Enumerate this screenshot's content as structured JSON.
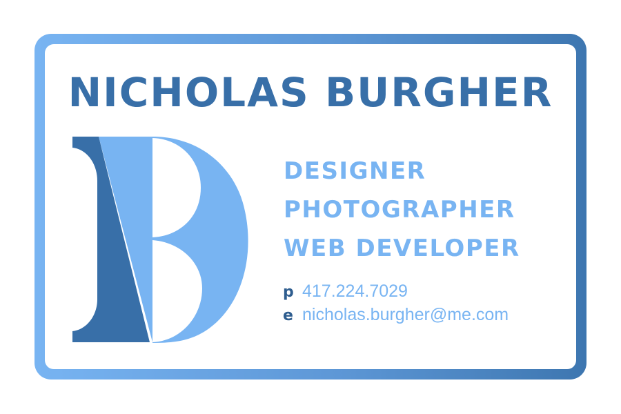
{
  "card": {
    "name": "NICHOLAS BURGHER",
    "monogram_letter": "B",
    "titles": [
      "DESIGNER",
      "PHOTOGRAPHER",
      "WEB DEVELOPER"
    ],
    "contact": {
      "phone_key": "p",
      "phone": "417.224.7029",
      "email_key": "e",
      "email": "nicholas.burgher@me.com"
    }
  },
  "colors": {
    "dark_blue": "#386fa8",
    "light_blue": "#78b4f2",
    "label_blue": "#2e5d8f",
    "background": "#ffffff"
  }
}
